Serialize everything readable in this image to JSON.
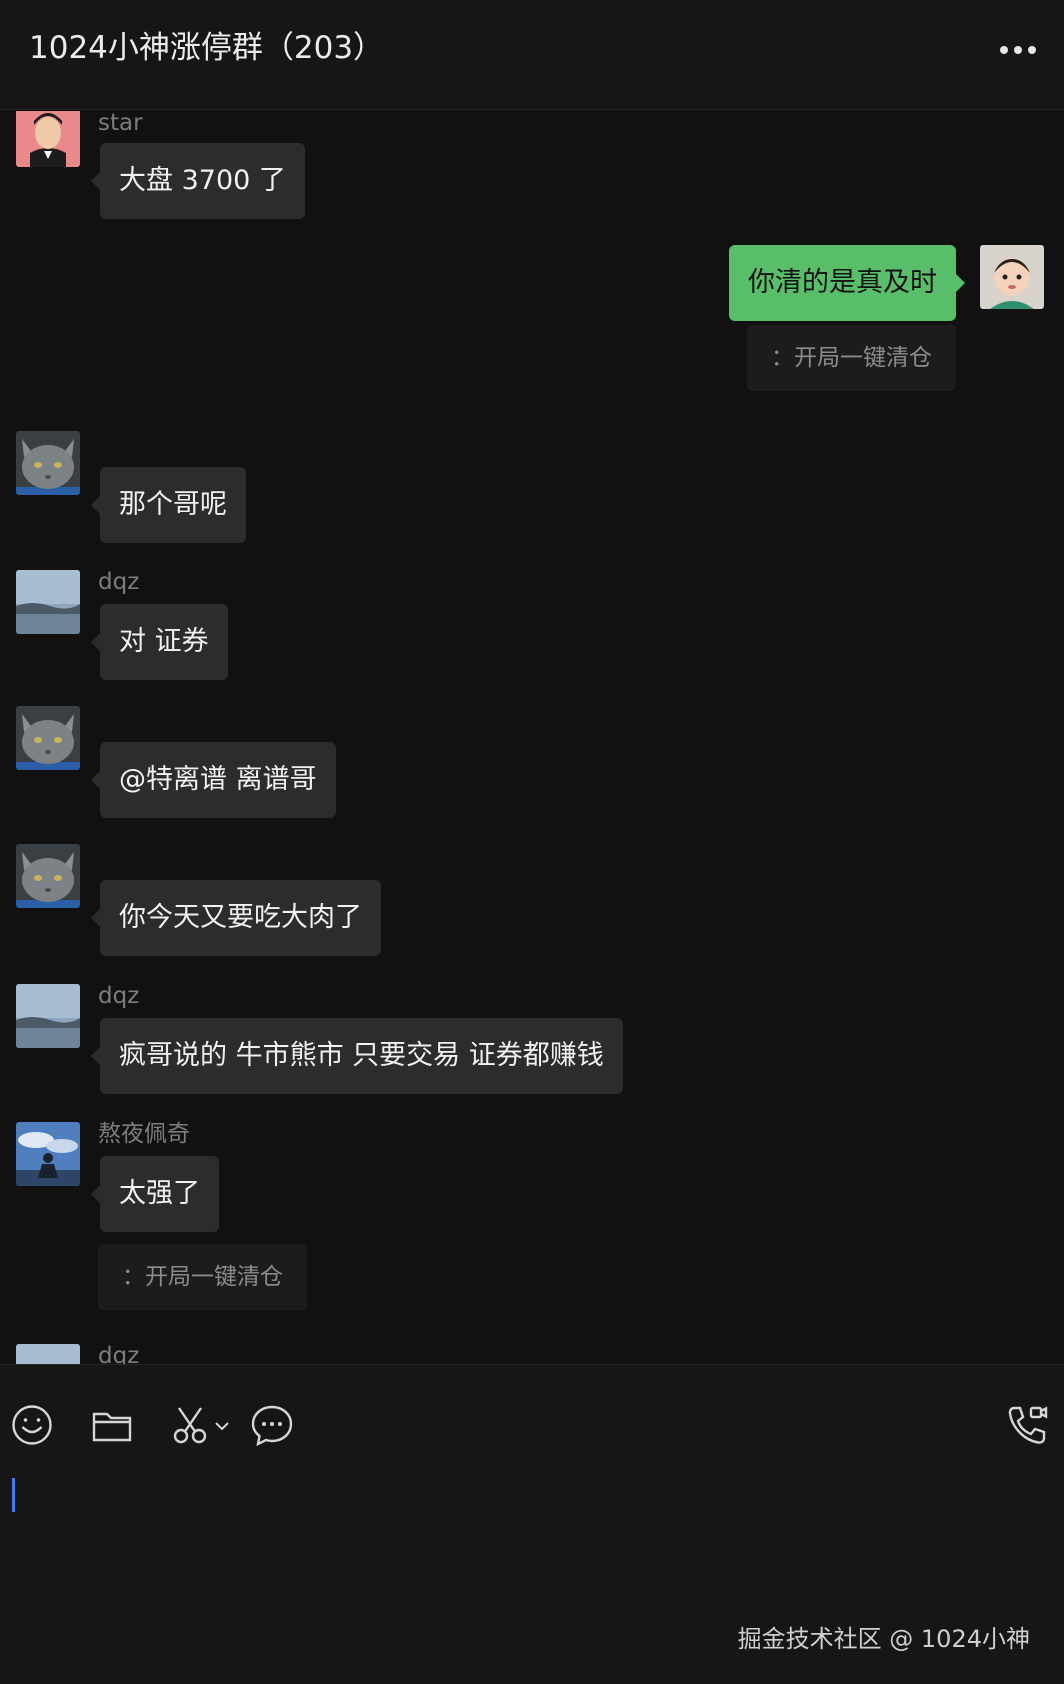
{
  "header": {
    "title": "1024小神涨停群（203）"
  },
  "messages": [
    {
      "sender": "star",
      "text": "大盘 3700 了",
      "side": "left"
    },
    {
      "sender": "",
      "text": "你清的是真及时",
      "side": "right",
      "quote": "：开局一键清仓"
    },
    {
      "sender": "",
      "text": "那个哥呢",
      "side": "left"
    },
    {
      "sender": "dqz",
      "text": "对 证券",
      "side": "left"
    },
    {
      "sender": "",
      "text": "@特离谱 离谱哥",
      "side": "left"
    },
    {
      "sender": "",
      "text": "你今天又要吃大肉了",
      "side": "left"
    },
    {
      "sender": "dqz",
      "text": "疯哥说的 牛市熊市 只要交易 证券都赚钱",
      "side": "left"
    },
    {
      "sender": "熬夜佩奇",
      "text": "太强了",
      "side": "left",
      "quote": "：开局一键清仓"
    },
    {
      "sender": "dqz",
      "text": "",
      "side": "left"
    }
  ],
  "toolbar": {
    "icons": [
      "emoji-icon",
      "folder-icon",
      "scissors-icon",
      "chat-bubble-icon",
      "phone-video-icon"
    ]
  },
  "composer": {
    "value": ""
  },
  "watermark": "掘金技术社区 @ 1024小神",
  "colors": {
    "background": "#111111",
    "bubble": "#2c2c2c",
    "own_bubble": "#58be6a",
    "caret": "#3d7cf4"
  }
}
